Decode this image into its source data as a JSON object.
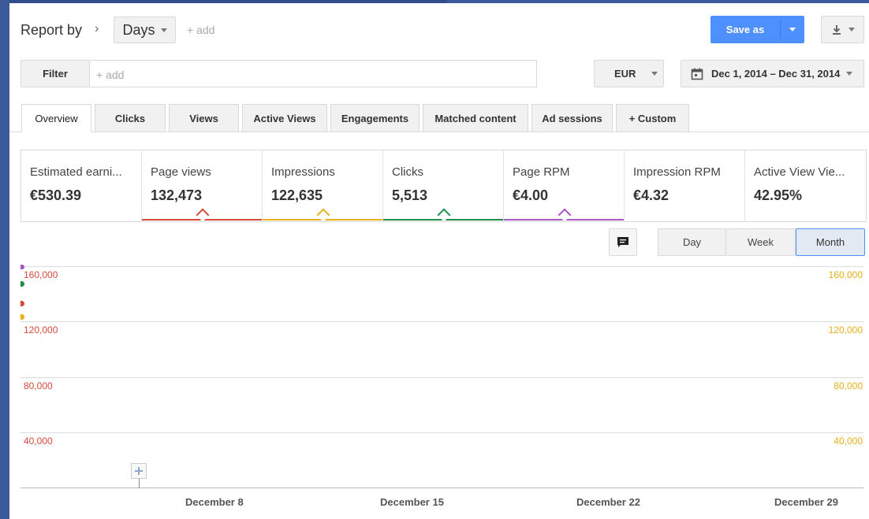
{
  "header": {
    "report_by_label": "Report by",
    "breadcrumb_sep": "›",
    "dimension_value": "Days",
    "add_dimension": "+ add",
    "save_as_label": "Save as"
  },
  "filter": {
    "label": "Filter",
    "placeholder": "+ add"
  },
  "currency": {
    "value": "EUR"
  },
  "date_range": {
    "value": "Dec 1, 2014 – Dec 31, 2014"
  },
  "tabs": [
    {
      "label": "Overview",
      "active": true
    },
    {
      "label": "Clicks"
    },
    {
      "label": "Views"
    },
    {
      "label": "Active Views"
    },
    {
      "label": "Engagements"
    },
    {
      "label": "Matched content"
    },
    {
      "label": "Ad sessions"
    },
    {
      "label": "+ Custom"
    }
  ],
  "metrics": [
    {
      "label": "Estimated earni...",
      "value": "€530.39",
      "color": ""
    },
    {
      "label": "Page views",
      "value": "132,473",
      "color": "#d64a3c"
    },
    {
      "label": "Impressions",
      "value": "122,635",
      "color": "#e8b019"
    },
    {
      "label": "Clicks",
      "value": "5,513",
      "color": "#1d8f48"
    },
    {
      "label": "Page RPM",
      "value": "€4.00",
      "color": "#a855c8"
    },
    {
      "label": "Impression RPM",
      "value": "€4.32",
      "color": ""
    },
    {
      "label": "Active View Vie...",
      "value": "42.95%",
      "color": ""
    }
  ],
  "granularity": {
    "options": [
      "Day",
      "Week",
      "Month"
    ],
    "selected": "Month"
  },
  "chart": {
    "left_axis_labels": [
      "160,000",
      "120,000",
      "80,000",
      "40,000"
    ],
    "right_axis_labels": [
      "160,000",
      "120,000",
      "80,000",
      "40,000"
    ],
    "x_labels": [
      "December 8",
      "December 15",
      "December 22",
      "December 29"
    ]
  },
  "colors": {
    "accent": "#4d90fe",
    "page_views": "#d64a3c",
    "impressions": "#e8b019",
    "clicks": "#1d8f48",
    "page_rpm": "#a855c8"
  }
}
